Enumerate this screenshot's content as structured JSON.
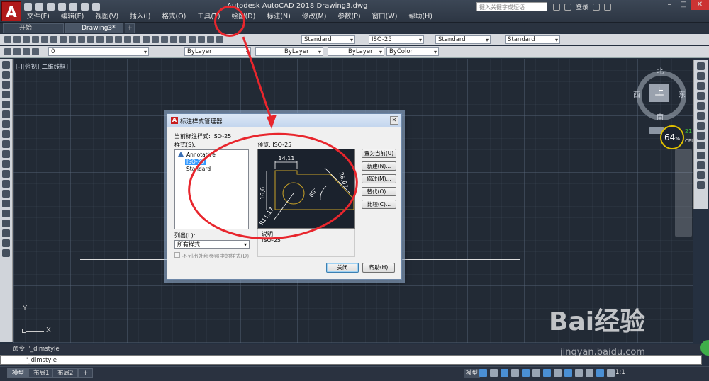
{
  "title_bar": {
    "app_title": "Autodesk AutoCAD 2018    Drawing3.dwg",
    "search_placeholder": "键入关键字或短语",
    "login_label": "登录"
  },
  "menu": [
    "文件(F)",
    "编辑(E)",
    "视图(V)",
    "插入(I)",
    "格式(O)",
    "工具(T)",
    "绘图(D)",
    "标注(N)",
    "修改(M)",
    "参数(P)",
    "窗口(W)",
    "帮助(H)"
  ],
  "file_tabs": {
    "start": "开始",
    "drawing": "Drawing3*",
    "add": "+"
  },
  "toolbar1": {
    "text_style": "Standard",
    "dim_style": "ISO-25",
    "table_style": "Standard",
    "mleader_style": "Standard"
  },
  "toolbar2": {
    "layer": "0",
    "color": "ByLayer",
    "linetype": "ByLayer",
    "lineweight": "ByLayer",
    "plot_style": "ByColor"
  },
  "viewport_label": "[-][俯视][二维线框]",
  "viewcube": {
    "top_face": "上",
    "north": "北",
    "south": "南",
    "east": "东",
    "west": "西"
  },
  "cpu_widget": {
    "percent": "64",
    "percent_unit": "%",
    "temperature": "21°C",
    "label": "CPU温度"
  },
  "ucs": {
    "x": "X",
    "y": "Y"
  },
  "dialog": {
    "title": "标注样式管理器",
    "current_style_label": "当前标注样式: ISO-25",
    "styles_label": "样式(S):",
    "styles": [
      "Annotative",
      "ISO-25",
      "Standard"
    ],
    "preview_label": "预览: ISO-25",
    "list_label": "列出(L):",
    "list_value": "所有样式",
    "checkbox_label": "不列出外部参照中的样式(D)",
    "description_label": "说明",
    "description_value": "ISO-25",
    "buttons": {
      "set_current": "置为当前(U)",
      "new": "新建(N)...",
      "modify": "修改(M)...",
      "override": "替代(O)...",
      "compare": "比较(C)..."
    },
    "close": "关闭",
    "help": "帮助(H)",
    "preview_dims": {
      "top": "14,11",
      "left": "16,6",
      "diag": "28,07",
      "angle": "60°",
      "radius": "R11,17"
    }
  },
  "command": {
    "history": "命令: '_dimstyle",
    "input": "'_dimstyle"
  },
  "layout_tabs": {
    "model": "模型",
    "layout1": "布局1",
    "layout2": "布局2",
    "add": "+"
  },
  "status": {
    "model": "模型",
    "scale": "1:1"
  },
  "watermark": {
    "brand": "Bai经验",
    "url": "jingyan.baidu.com"
  },
  "colors": {
    "annotation": "#e8262d",
    "selection": "#3399ff",
    "brand": "#b01a1a"
  }
}
